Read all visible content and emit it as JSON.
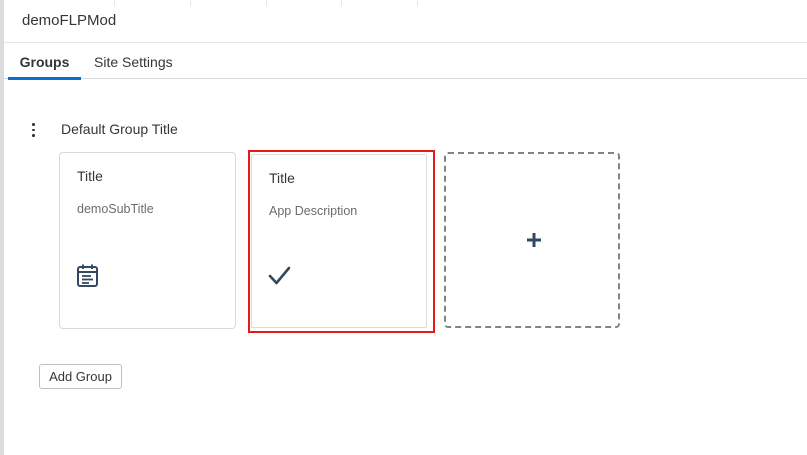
{
  "app": {
    "title": "demoFLPMod"
  },
  "tabs": [
    {
      "label": "Groups",
      "selected": true
    },
    {
      "label": "Site Settings",
      "selected": false
    }
  ],
  "group": {
    "title": "Default Group Title",
    "tiles": [
      {
        "title": "Title",
        "subtitle": "demoSubTitle",
        "icon": "calendar-list-icon"
      },
      {
        "title": "Title",
        "subtitle": "App Description",
        "icon": "checkmark-icon"
      }
    ],
    "add_tile_icon": "plus-icon"
  },
  "actions": {
    "add_group_label": "Add Group"
  },
  "colors": {
    "accent": "#0a6ed1",
    "icon": "#32495f",
    "highlight": "#e61a1a",
    "text": "#32363a"
  }
}
